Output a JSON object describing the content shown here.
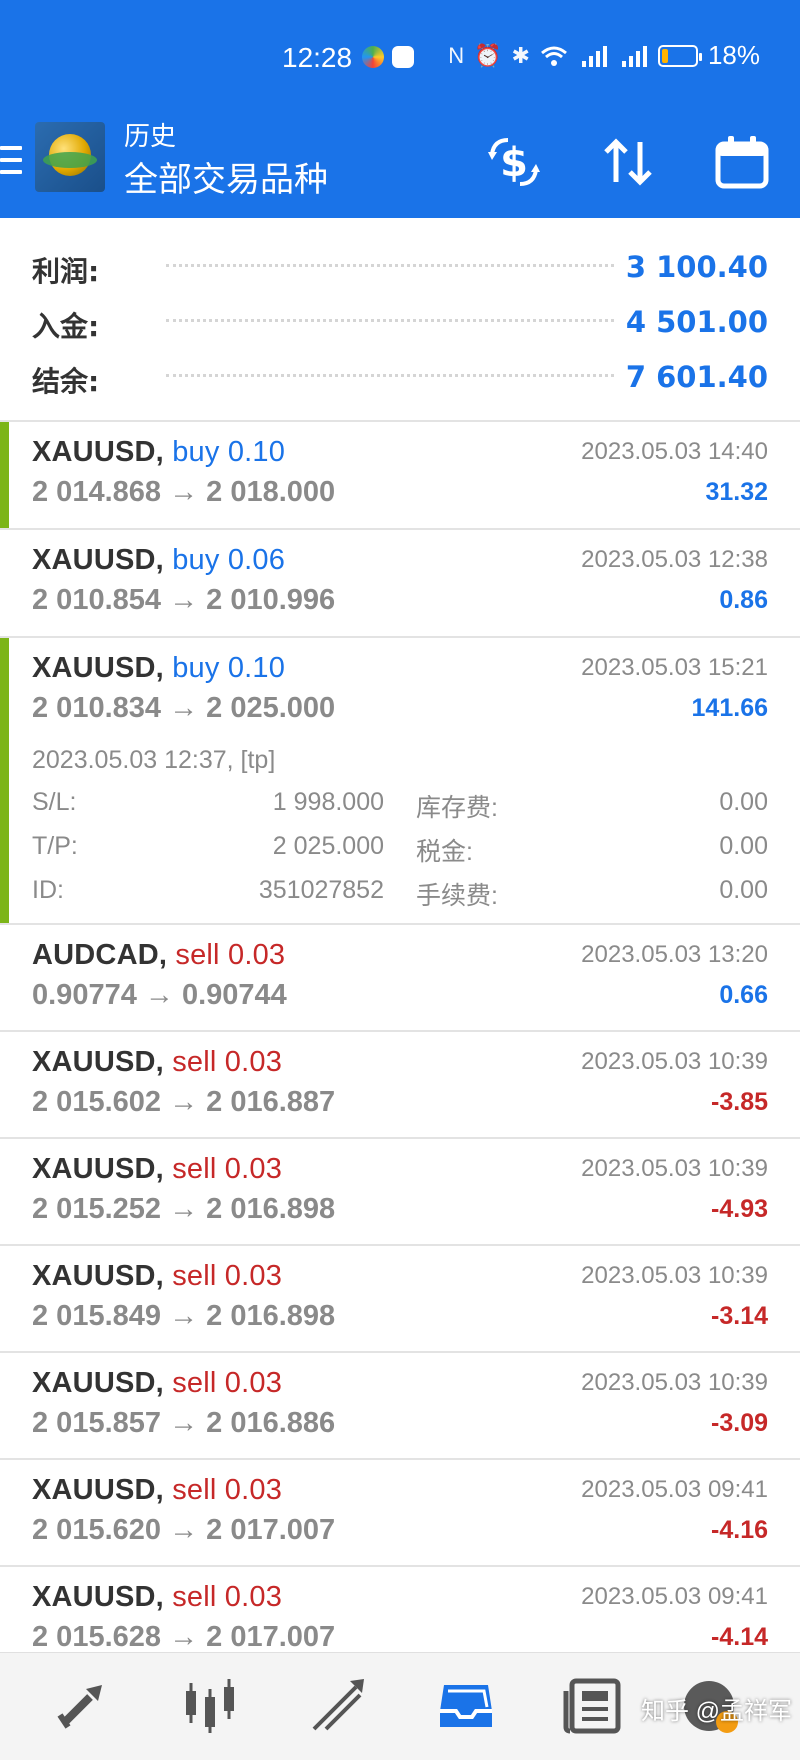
{
  "status_bar": {
    "time": "12:28",
    "battery": "18%",
    "battery_level": 0.18,
    "network_badges": [
      "4G",
      "4G"
    ]
  },
  "toolbar": {
    "subtitle": "历史",
    "title": "全部交易品种",
    "icons": [
      "menu-icon",
      "app-logo",
      "currency-exchange-icon",
      "sort-icon",
      "calendar-icon"
    ]
  },
  "summary": {
    "profit": {
      "label": "利润:",
      "value": "3 100.40"
    },
    "deposit": {
      "label": "入金:",
      "value": "4 501.00"
    },
    "balance": {
      "label": "结余:",
      "value": "7 601.40"
    }
  },
  "trades": [
    {
      "symbol": "XAUUSD,",
      "direction": "buy",
      "volume": "0.10",
      "price_open": "2 014.868",
      "price_close": "2 018.000",
      "time": "2023.05.03 14:40",
      "profit": "31.32"
    },
    {
      "symbol": "XAUUSD,",
      "direction": "buy",
      "volume": "0.06",
      "price_open": "2 010.854",
      "price_close": "2 010.996",
      "time": "2023.05.03 12:38",
      "profit": "0.86"
    },
    {
      "symbol": "XAUUSD,",
      "direction": "buy",
      "volume": "0.10",
      "price_open": "2 010.834",
      "price_close": "2 025.000",
      "time": "2023.05.03 15:21",
      "profit": "141.66",
      "details": {
        "open_time": "2023.05.03 12:37, [tp]",
        "sl_label": "S/L:",
        "sl": "1 998.000",
        "tp_label": "T/P:",
        "tp": "2 025.000",
        "id_label": "ID:",
        "id": "351027852",
        "swap_label": "库存费:",
        "swap": "0.00",
        "tax_label": "税金:",
        "tax": "0.00",
        "fee_label": "手续费:",
        "fee": "0.00"
      }
    },
    {
      "symbol": "AUDCAD,",
      "direction": "sell",
      "volume": "0.03",
      "price_open": "0.90774",
      "price_close": "0.90744",
      "time": "2023.05.03 13:20",
      "profit": "0.66"
    },
    {
      "symbol": "XAUUSD,",
      "direction": "sell",
      "volume": "0.03",
      "price_open": "2 015.602",
      "price_close": "2 016.887",
      "time": "2023.05.03 10:39",
      "profit": "-3.85"
    },
    {
      "symbol": "XAUUSD,",
      "direction": "sell",
      "volume": "0.03",
      "price_open": "2 015.252",
      "price_close": "2 016.898",
      "time": "2023.05.03 10:39",
      "profit": "-4.93"
    },
    {
      "symbol": "XAUUSD,",
      "direction": "sell",
      "volume": "0.03",
      "price_open": "2 015.849",
      "price_close": "2 016.898",
      "time": "2023.05.03 10:39",
      "profit": "-3.14"
    },
    {
      "symbol": "XAUUSD,",
      "direction": "sell",
      "volume": "0.03",
      "price_open": "2 015.857",
      "price_close": "2 016.886",
      "time": "2023.05.03 10:39",
      "profit": "-3.09"
    },
    {
      "symbol": "XAUUSD,",
      "direction": "sell",
      "volume": "0.03",
      "price_open": "2 015.620",
      "price_close": "2 017.007",
      "time": "2023.05.03 09:41",
      "profit": "-4.16"
    },
    {
      "symbol": "XAUUSD,",
      "direction": "sell",
      "volume": "0.03",
      "price_open": "2 015.628",
      "price_close": "2 017.007",
      "time": "2023.05.03 09:41",
      "profit": "-4.14"
    }
  ],
  "arrow": "→",
  "bottom_nav": {
    "items": [
      "quotes-icon",
      "chart-icon",
      "trade-icon",
      "history-icon",
      "news-icon",
      "chat-icon"
    ],
    "active": "history-icon",
    "watermark": "知乎 @孟祥军"
  },
  "colors": {
    "header": "#1a73e8",
    "buy": "#1a73e8",
    "sell": "#c62828",
    "marker": "#7cb518",
    "muted": "#8a8a8a"
  }
}
